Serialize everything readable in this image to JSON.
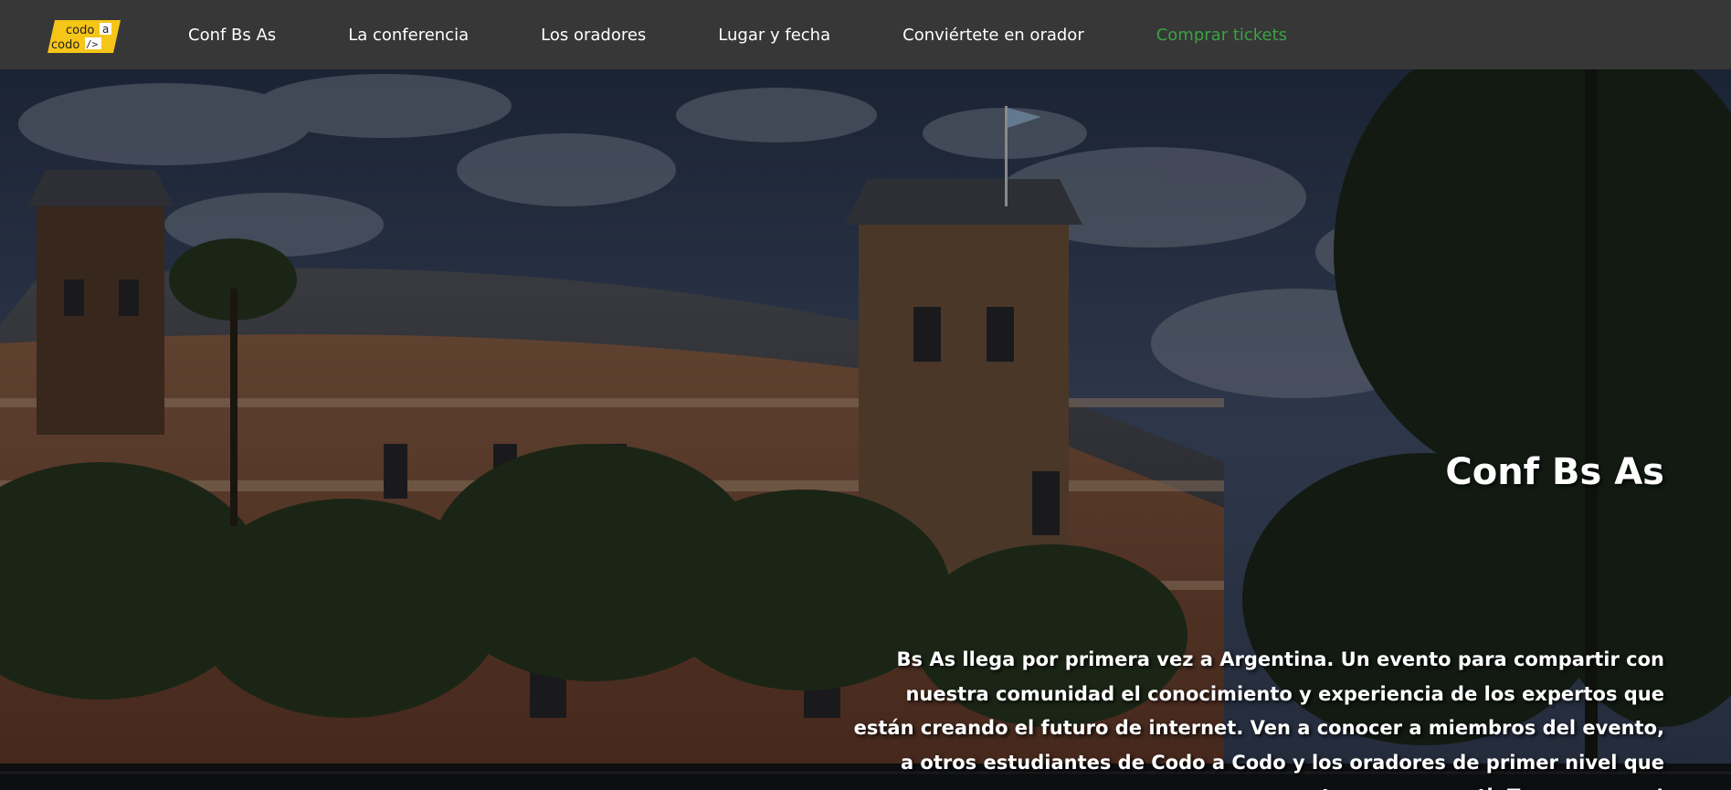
{
  "header": {
    "logo": {
      "line1": "codo",
      "line1_tag": "a",
      "line2": "codo",
      "line2_tag": "/>",
      "accent_color": "#f5c518",
      "icon": "codo-a-codo-logo"
    },
    "nav": [
      {
        "label": "Conf Bs As"
      },
      {
        "label": "La conferencia"
      },
      {
        "label": "Los oradores"
      },
      {
        "label": "Lugar y fecha"
      },
      {
        "label": "Conviértete en orador"
      },
      {
        "label": "Comprar tickets",
        "color": "#3ba245"
      }
    ],
    "background": "#373737"
  },
  "hero": {
    "title": "Conf Bs As",
    "description": "Bs As llega por primera vez a Argentina. Un evento para compartir con nuestra comunidad el conocimiento y experiencia de los expertos que están creando el futuro de internet. Ven a conocer a miembros del evento, a otros estudiantes de Codo a Codo y los oradores de primer nivel que tenemos para ti. Te esperamos!",
    "image": "palacio-de-aguas-corrientes-photo"
  }
}
